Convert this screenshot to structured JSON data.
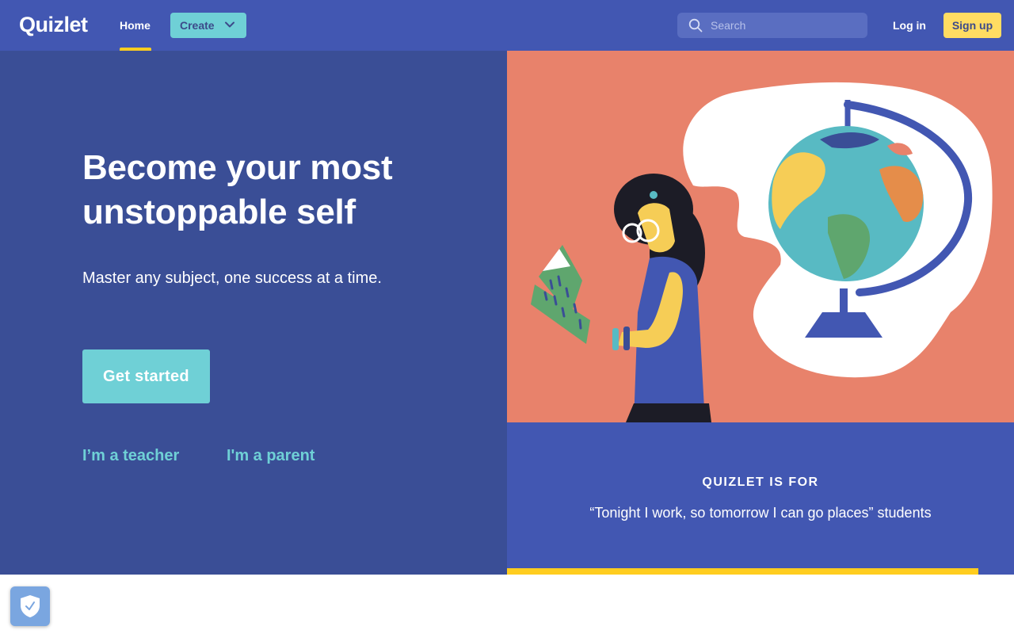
{
  "nav": {
    "logo": "Quizlet",
    "home_label": "Home",
    "create_label": "Create",
    "search_placeholder": "Search",
    "login_label": "Log in",
    "signup_label": "Sign up"
  },
  "hero": {
    "headline": "Become your most unstoppable self",
    "subline": "Master any subject, one success at a time.",
    "cta_label": "Get started",
    "teacher_link": "I’m a teacher",
    "parent_link": "I'm a parent"
  },
  "quizlet_for": {
    "title": "QUIZLET IS FOR",
    "quote": "“Tonight I work, so tomorrow I can go places” students",
    "progress_fraction": 0.93
  },
  "colors": {
    "nav_bg": "#4257b2",
    "hero_bg": "#3a4e96",
    "accent_teal": "#6fd0d6",
    "accent_yellow": "#ffcd1f",
    "illustration_bg": "#e8826b"
  },
  "icons": {
    "search": "search-icon",
    "create_dropdown": "chevron-down-icon",
    "privacy": "shield-check-icon"
  }
}
